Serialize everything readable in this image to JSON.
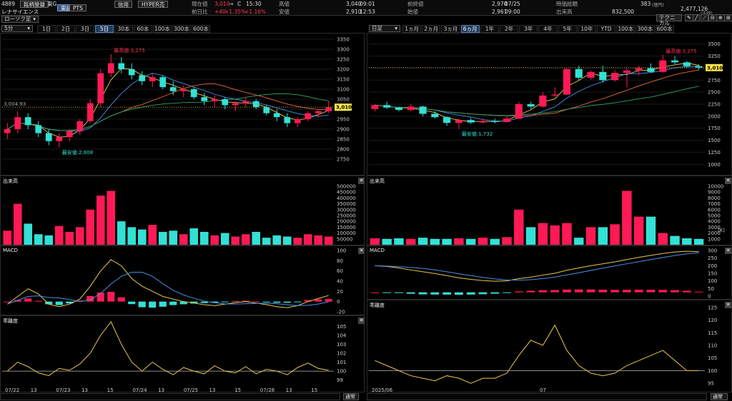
{
  "header": {
    "code": "4889",
    "mode_label": "銘柄登録",
    "exchange": "東G",
    "tabs": [
      "東証",
      "PTS"
    ],
    "company": "レナサイエンス",
    "btn_credit": "信用",
    "btn_hyper": "HYPER売"
  },
  "quote": {
    "current_label": "現在値",
    "current": "3,010",
    "arrow": "→",
    "flag": "C",
    "time": "15:30",
    "prev_label": "前日比",
    "prev_change": "+40",
    "prev_pct": "+1.35%",
    "pct2": "+1.16%",
    "high_label": "高値",
    "high": "3,040",
    "high_time": "09:01",
    "low_label": "安値",
    "low": "2,910",
    "low_time": "12:53",
    "prevclose_label": "前終値",
    "prevclose": "2,970",
    "prevclose_date": "07/25",
    "open_label": "始値",
    "open": "2,961",
    "open_time": "09:00",
    "mcap_label": "時価総額",
    "mcap": "383",
    "mcap_unit": "(億円)",
    "volume_label": "出来高",
    "volume": "832,500",
    "value": "2,477,126",
    "value_unit": "(千円)"
  },
  "toolbar": {
    "chart_type": "ローソク足",
    "tech_btn": "テクニカル"
  },
  "left": {
    "interval": "5分",
    "periods": [
      "1日",
      "2日",
      "3日",
      "5日",
      "30本",
      "60本",
      "100本",
      "300本",
      "600本"
    ],
    "active": "5日",
    "price_ticks": [
      "3350",
      "3300",
      "3250",
      "3200",
      "3150",
      "3100",
      "3050",
      "3000",
      "2950",
      "2900",
      "2850",
      "2800",
      "2750"
    ],
    "current_tag": "3,010",
    "dotted_label": "3,004.93",
    "high_note": "最高値:3,275",
    "low_note": "最安値:2,808",
    "vol_label": "出来高",
    "vol_ticks": [
      "500000",
      "450000",
      "400000",
      "350000",
      "300000",
      "250000",
      "200000",
      "150000",
      "100000",
      "50000"
    ],
    "macd_label": "MACD",
    "macd_ticks": [
      "100",
      "80",
      "60",
      "40",
      "20",
      "0",
      "-20"
    ],
    "dev_label": "乖離度",
    "dev_ticks": [
      "105",
      "104",
      "103",
      "102",
      "101",
      "100",
      "99"
    ],
    "dates": [
      "07/22",
      "13",
      "07/23",
      "13",
      "15",
      "07/24",
      "13",
      "07/25",
      "13",
      "15",
      "07/28",
      "13",
      "15"
    ],
    "scroll_btn": "通常"
  },
  "right": {
    "interval": "日足",
    "periods": [
      "1ヵ月",
      "2ヵ月",
      "3ヵ月",
      "6ヵ月",
      "1年",
      "2年",
      "3年",
      "4年",
      "5年",
      "10年",
      "YTD",
      "100本",
      "300本",
      "600本"
    ],
    "active": "6ヵ月",
    "price_ticks": [
      "3500",
      "3250",
      "3000",
      "2750",
      "2500",
      "2250",
      "2000",
      "1750",
      "1500",
      "1250",
      "1000"
    ],
    "current_tag": "3,010",
    "high_note": "最高値:3,275",
    "low_note": "最安値:1,732",
    "vol_label": "出来高",
    "vol_ticks": [
      "10000",
      "9000",
      "8000",
      "7000",
      "6000",
      "5000",
      "4000",
      "3000",
      "2000",
      "1000"
    ],
    "vol_unit": "(K)",
    "macd_label": "MACD",
    "macd_ticks": [
      "300",
      "250",
      "200",
      "150",
      "100",
      "50",
      "0"
    ],
    "dev_label": "乖離度",
    "dev_ticks": [
      "125",
      "120",
      "115",
      "110",
      "105",
      "100",
      "95"
    ],
    "dates": [
      "2025/06",
      "07"
    ],
    "scroll_btn": "通常"
  },
  "chart_data": [
    {
      "type": "candlestick",
      "title": "5分足",
      "ylim": [
        2700,
        3350
      ],
      "current": 3010,
      "high": 3275,
      "low": 2808,
      "candles": [
        {
          "o": 2880,
          "h": 2930,
          "l": 2850,
          "c": 2900
        },
        {
          "o": 2900,
          "h": 2990,
          "l": 2880,
          "c": 2960
        },
        {
          "o": 2960,
          "h": 2980,
          "l": 2900,
          "c": 2920
        },
        {
          "o": 2920,
          "h": 2940,
          "l": 2860,
          "c": 2880
        },
        {
          "o": 2880,
          "h": 2900,
          "l": 2820,
          "c": 2840
        },
        {
          "o": 2840,
          "h": 2880,
          "l": 2808,
          "c": 2860
        },
        {
          "o": 2860,
          "h": 2900,
          "l": 2840,
          "c": 2890
        },
        {
          "o": 2890,
          "h": 2950,
          "l": 2870,
          "c": 2940
        },
        {
          "o": 2940,
          "h": 3050,
          "l": 2930,
          "c": 3030
        },
        {
          "o": 3030,
          "h": 3200,
          "l": 3010,
          "c": 3180
        },
        {
          "o": 3180,
          "h": 3275,
          "l": 3160,
          "c": 3230
        },
        {
          "o": 3230,
          "h": 3260,
          "l": 3180,
          "c": 3200
        },
        {
          "o": 3200,
          "h": 3230,
          "l": 3150,
          "c": 3170
        },
        {
          "o": 3170,
          "h": 3190,
          "l": 3120,
          "c": 3140
        },
        {
          "o": 3140,
          "h": 3180,
          "l": 3110,
          "c": 3160
        },
        {
          "o": 3160,
          "h": 3170,
          "l": 3100,
          "c": 3110
        },
        {
          "o": 3110,
          "h": 3140,
          "l": 3070,
          "c": 3090
        },
        {
          "o": 3090,
          "h": 3120,
          "l": 3060,
          "c": 3100
        },
        {
          "o": 3100,
          "h": 3110,
          "l": 3050,
          "c": 3060
        },
        {
          "o": 3060,
          "h": 3080,
          "l": 3020,
          "c": 3040
        },
        {
          "o": 3040,
          "h": 3070,
          "l": 3010,
          "c": 3050
        },
        {
          "o": 3050,
          "h": 3060,
          "l": 3000,
          "c": 3020
        },
        {
          "o": 3020,
          "h": 3040,
          "l": 2990,
          "c": 3030
        },
        {
          "o": 3030,
          "h": 3060,
          "l": 3010,
          "c": 3040
        },
        {
          "o": 3040,
          "h": 3050,
          "l": 3000,
          "c": 3010
        },
        {
          "o": 3010,
          "h": 3020,
          "l": 2970,
          "c": 2980
        },
        {
          "o": 2980,
          "h": 3000,
          "l": 2940,
          "c": 2960
        },
        {
          "o": 2960,
          "h": 2980,
          "l": 2910,
          "c": 2930
        },
        {
          "o": 2930,
          "h": 2960,
          "l": 2910,
          "c": 2950
        },
        {
          "o": 2950,
          "h": 2990,
          "l": 2940,
          "c": 2980
        },
        {
          "o": 2980,
          "h": 3000,
          "l": 2960,
          "c": 2990
        },
        {
          "o": 2990,
          "h": 3040,
          "l": 2980,
          "c": 3010
        }
      ],
      "volume": [
        120000,
        350000,
        180000,
        90000,
        80000,
        160000,
        110000,
        150000,
        300000,
        420000,
        460000,
        200000,
        150000,
        130000,
        170000,
        110000,
        120000,
        90000,
        140000,
        110000,
        80000,
        100000,
        70000,
        90000,
        110000,
        60000,
        80000,
        70000,
        60000,
        90000,
        80000,
        70000
      ],
      "macd": [
        -5,
        10,
        25,
        15,
        -5,
        -10,
        -5,
        5,
        30,
        60,
        82,
        70,
        45,
        30,
        20,
        10,
        5,
        0,
        -3,
        -6,
        -8,
        -5,
        -2,
        0,
        -3,
        -6,
        -10,
        -12,
        -8,
        0,
        6,
        12
      ],
      "deviation": [
        100,
        101,
        100.5,
        99.8,
        99.5,
        100.3,
        100.1,
        100.8,
        102,
        104,
        105.5,
        103,
        101,
        100,
        101,
        100.2,
        99.6,
        100.4,
        100,
        99.7,
        100.6,
        100,
        99.8,
        100.5,
        99.7,
        100.2,
        100,
        99.6,
        100.4,
        100.9,
        100.3,
        100.1
      ]
    },
    {
      "type": "candlestick",
      "title": "日足",
      "ylim": [
        900,
        3600
      ],
      "current": 3010,
      "high": 3275,
      "low": 1732,
      "candles": [
        {
          "o": 2150,
          "h": 2250,
          "l": 2100,
          "c": 2230
        },
        {
          "o": 2230,
          "h": 2300,
          "l": 2150,
          "c": 2180
        },
        {
          "o": 2180,
          "h": 2200,
          "l": 2100,
          "c": 2130
        },
        {
          "o": 2130,
          "h": 2250,
          "l": 2100,
          "c": 2200
        },
        {
          "o": 2200,
          "h": 2220,
          "l": 2000,
          "c": 2050
        },
        {
          "o": 2050,
          "h": 2100,
          "l": 1950,
          "c": 1980
        },
        {
          "o": 1980,
          "h": 2000,
          "l": 1800,
          "c": 1860
        },
        {
          "o": 1860,
          "h": 1950,
          "l": 1732,
          "c": 1920
        },
        {
          "o": 1920,
          "h": 1960,
          "l": 1840,
          "c": 1870
        },
        {
          "o": 1870,
          "h": 1950,
          "l": 1850,
          "c": 1900
        },
        {
          "o": 1900,
          "h": 1950,
          "l": 1850,
          "c": 1880
        },
        {
          "o": 1880,
          "h": 2000,
          "l": 1870,
          "c": 1950
        },
        {
          "o": 1950,
          "h": 2300,
          "l": 1940,
          "c": 2250
        },
        {
          "o": 2250,
          "h": 2300,
          "l": 2150,
          "c": 2200
        },
        {
          "o": 2200,
          "h": 2500,
          "l": 2180,
          "c": 2430
        },
        {
          "o": 2430,
          "h": 2600,
          "l": 2400,
          "c": 2450
        },
        {
          "o": 2450,
          "h": 3000,
          "l": 2440,
          "c": 2980
        },
        {
          "o": 2980,
          "h": 3050,
          "l": 2750,
          "c": 2800
        },
        {
          "o": 2800,
          "h": 2950,
          "l": 2760,
          "c": 2920
        },
        {
          "o": 2920,
          "h": 3050,
          "l": 2700,
          "c": 2750
        },
        {
          "o": 2750,
          "h": 2960,
          "l": 2720,
          "c": 2900
        },
        {
          "o": 2900,
          "h": 3000,
          "l": 2600,
          "c": 2950
        },
        {
          "o": 2950,
          "h": 3050,
          "l": 2850,
          "c": 3000
        },
        {
          "o": 3000,
          "h": 3100,
          "l": 2900,
          "c": 2920
        },
        {
          "o": 2920,
          "h": 3275,
          "l": 2900,
          "c": 3160
        },
        {
          "o": 3160,
          "h": 3250,
          "l": 3080,
          "c": 3120
        },
        {
          "o": 3120,
          "h": 3150,
          "l": 3000,
          "c": 3040
        },
        {
          "o": 3040,
          "h": 3080,
          "l": 2960,
          "c": 3010
        }
      ],
      "volume": [
        1100,
        1000,
        1100,
        1000,
        1200,
        1000,
        1000,
        1100,
        1000,
        1200,
        1000,
        1300,
        6000,
        3000,
        3700,
        3300,
        3700,
        1200,
        3000,
        3000,
        3500,
        9200,
        4800,
        4800,
        2000,
        1500,
        1100,
        1000
      ],
      "macd": [
        200,
        195,
        185,
        172,
        160,
        148,
        135,
        120,
        110,
        102,
        98,
        100,
        115,
        125,
        138,
        150,
        170,
        185,
        200,
        212,
        225,
        240,
        255,
        268,
        280,
        290,
        295,
        292
      ],
      "deviation": [
        104,
        102,
        100,
        98,
        97,
        96,
        98,
        97,
        95,
        97,
        97,
        99,
        106,
        112,
        110,
        118,
        108,
        102,
        99,
        98,
        99,
        102,
        104,
        106,
        108,
        104,
        100,
        100
      ]
    }
  ]
}
